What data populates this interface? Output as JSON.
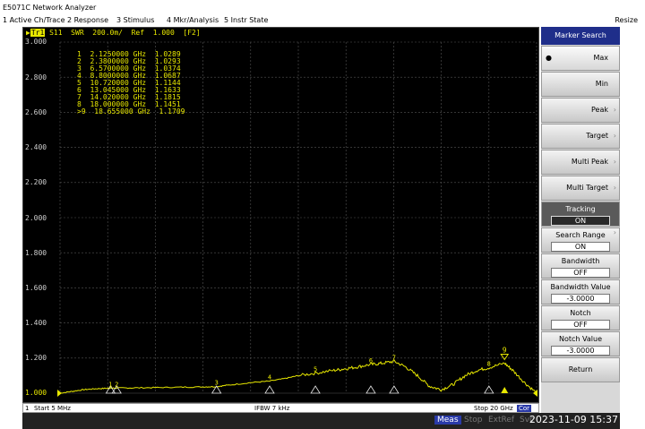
{
  "window": {
    "title": "E5071C Network Analyzer"
  },
  "menu": {
    "items": [
      "1 Active Ch/Trace",
      "2 Response",
      "3 Stimulus",
      "4 Mkr/Analysis",
      "5 Instr State"
    ],
    "resize": "Resize"
  },
  "trace": {
    "tag": "Tr1",
    "header": " S11  SWR  200.0m/  Ref  1.000  [F2]",
    "color": "#e8e800"
  },
  "axis": {
    "y_ticks": [
      "3.000",
      "2.800",
      "2.600",
      "2.400",
      "2.200",
      "2.000",
      "1.800",
      "1.600",
      "1.400",
      "1.200",
      "1.000"
    ]
  },
  "markers": [
    {
      "num": "1",
      "freq": "2.1250000 GHz",
      "value": "1.0289"
    },
    {
      "num": "2",
      "freq": "2.3800000 GHz",
      "value": "1.0293"
    },
    {
      "num": "3",
      "freq": "6.5700000 GHz",
      "value": "1.0374"
    },
    {
      "num": "4",
      "freq": "8.8000000 GHz",
      "value": "1.0687"
    },
    {
      "num": "5",
      "freq": "10.720000 GHz",
      "value": "1.1144"
    },
    {
      "num": "6",
      "freq": "13.045000 GHz",
      "value": "1.1633"
    },
    {
      "num": "7",
      "freq": "14.020000 GHz",
      "value": "1.1815"
    },
    {
      "num": "8",
      "freq": "18.000000 GHz",
      "value": "1.1451"
    },
    {
      "num": ">9",
      "freq": "18.655000 GHz",
      "value": "1.1709"
    }
  ],
  "chart_data": {
    "type": "line",
    "x_unit": "GHz",
    "xlim": [
      0.005,
      20
    ],
    "ylim": [
      1.0,
      3.0
    ],
    "series": [
      {
        "x": [
          0.005,
          0.5,
          1,
          1.5,
          2,
          2.125,
          2.38,
          3,
          4,
          5,
          6,
          6.57,
          7,
          8,
          8.8,
          9.5,
          10,
          10.72,
          11.5,
          12,
          12.5,
          13.045,
          13.5,
          14.02,
          14.5,
          15,
          15.5,
          16,
          16.5,
          17,
          17.5,
          18,
          18.655,
          19,
          19.5,
          20
        ],
        "y": [
          1.0,
          1.01,
          1.02,
          1.025,
          1.028,
          1.0289,
          1.0293,
          1.03,
          1.032,
          1.034,
          1.036,
          1.0374,
          1.045,
          1.06,
          1.0687,
          1.085,
          1.1,
          1.1144,
          1.13,
          1.14,
          1.15,
          1.1633,
          1.17,
          1.1815,
          1.15,
          1.1,
          1.04,
          1.02,
          1.05,
          1.1,
          1.13,
          1.1451,
          1.1709,
          1.13,
          1.06,
          1.0
        ]
      }
    ]
  },
  "status": {
    "channel": "1",
    "start": "Start 5 MHz",
    "ifbw": "IFBW 7 kHz",
    "stop": "Stop 20 GHz",
    "cor": "Cor"
  },
  "bottom": {
    "meas": "Meas",
    "stop": "Stop",
    "extref": "ExtRef",
    "svc": "Svc",
    "datetime": "2023-11-09 15:37"
  },
  "softkeys": {
    "title": "Marker Search",
    "max": "Max",
    "min": "Min",
    "peak": "Peak",
    "target": "Target",
    "multi_peak": "Multi Peak",
    "multi_target": "Multi Target",
    "tracking": {
      "label": "Tracking",
      "value": "ON"
    },
    "search_range": {
      "label": "Search Range",
      "value": "ON"
    },
    "bandwidth": {
      "label": "Bandwidth",
      "value": "OFF"
    },
    "bandwidth_value": {
      "label": "Bandwidth Value",
      "value": "-3.0000"
    },
    "notch": {
      "label": "Notch",
      "value": "OFF"
    },
    "notch_value": {
      "label": "Notch Value",
      "value": "-3.0000"
    },
    "return": "Return"
  }
}
